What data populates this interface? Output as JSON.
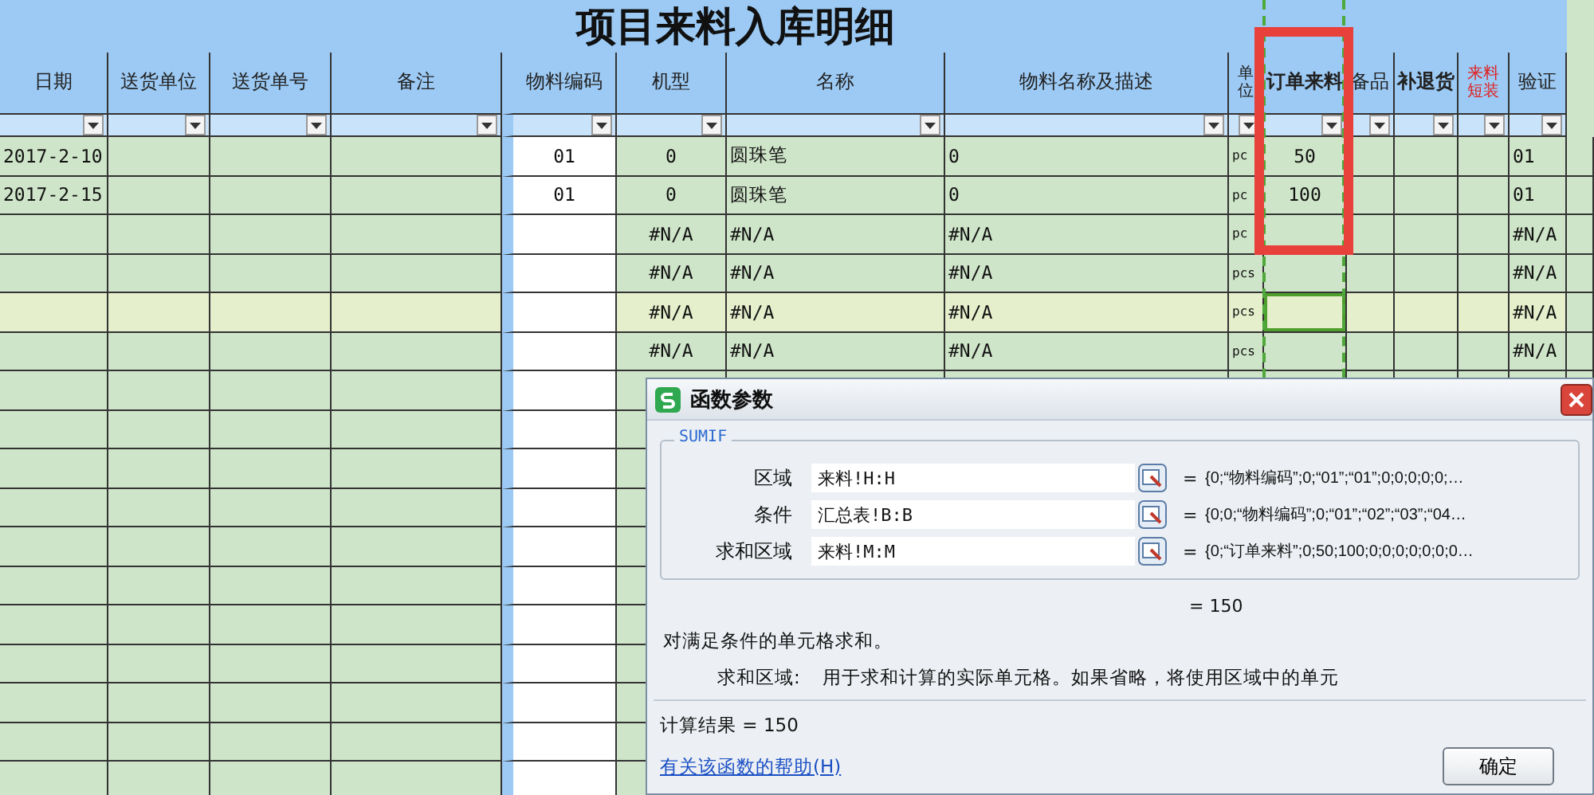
{
  "sheet": {
    "title": "项目来料入库明细",
    "columns": [
      {
        "label": "日期",
        "kind": "plain"
      },
      {
        "label": "送货单位",
        "kind": "plain"
      },
      {
        "label": "送货单号",
        "kind": "plain"
      },
      {
        "label": "备注",
        "kind": "plain"
      },
      {
        "label": "物料编码",
        "kind": "plain"
      },
      {
        "label": "机型",
        "kind": "plain"
      },
      {
        "label": "名称",
        "kind": "plain"
      },
      {
        "label": "物料名称及描述",
        "kind": "plain"
      },
      {
        "label": "单位",
        "kind": "narrow"
      },
      {
        "label": "订单来料",
        "kind": "bold"
      },
      {
        "label": "备品",
        "kind": "plain"
      },
      {
        "label": "补退货",
        "kind": "bold"
      },
      {
        "label": "来料短装",
        "kind": "alert"
      },
      {
        "label": "验证",
        "kind": "plain"
      }
    ],
    "rows": [
      {
        "selected": false,
        "cells": {
          "0": "2017-2-10",
          "4": "01",
          "5": "0",
          "6": "圆珠笔",
          "7": "0",
          "8": "pc",
          "9": "50",
          "13": "01"
        }
      },
      {
        "selected": false,
        "cells": {
          "0": "2017-2-15",
          "4": "01",
          "5": "0",
          "6": "圆珠笔",
          "7": "0",
          "8": "pc",
          "9": "100",
          "13": "01"
        }
      },
      {
        "selected": false,
        "cells": {
          "5": "#N/A",
          "6": "#N/A",
          "7": "#N/A",
          "8": "pc",
          "13": "#N/A"
        }
      },
      {
        "selected": false,
        "cells": {
          "5": "#N/A",
          "6": "#N/A",
          "7": "#N/A",
          "8": "pcs",
          "13": "#N/A"
        }
      },
      {
        "selected": true,
        "cells": {
          "5": "#N/A",
          "6": "#N/A",
          "7": "#N/A",
          "8": "pcs",
          "13": "#N/A"
        }
      },
      {
        "selected": false,
        "cells": {
          "5": "#N/A",
          "6": "#N/A",
          "7": "#N/A",
          "8": "pcs",
          "13": "#N/A"
        }
      }
    ]
  },
  "dialog": {
    "title": "函数参数",
    "function": "SUMIF",
    "args": [
      {
        "label": "区域",
        "value": "来料!H:H",
        "equals": "=",
        "result": "{0;“物料编码”;0;“01”;“01”;0;0;0;0;0;…"
      },
      {
        "label": "条件",
        "value": "汇总表!B:B",
        "equals": "=",
        "result": "{0;0;“物料编码”;0;“01”;“02”;“03”;“04…"
      },
      {
        "label": "求和区域",
        "value": "来料!M:M",
        "equals": "=",
        "result": "{0;“订单来料”;0;50;100;0;0;0;0;0;0;0…"
      }
    ],
    "formula_result": "= 150",
    "description": "对满足条件的单元格求和。",
    "arg_help_label": "求和区域:",
    "arg_help": "用于求和计算的实际单元格。如果省略，将使用区域中的单元",
    "calc_result": "计算结果 = 150",
    "help_link": "有关该函数的帮助(H)",
    "ok_button": "确定"
  }
}
